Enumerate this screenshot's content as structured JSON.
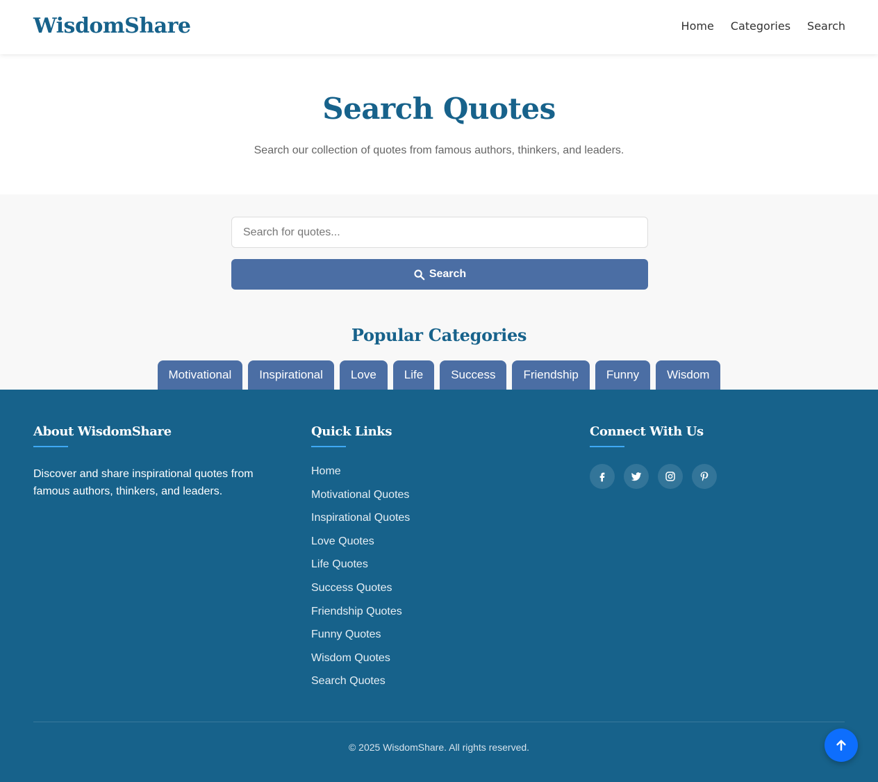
{
  "header": {
    "brand": "WisdomShare",
    "nav": [
      "Home",
      "Categories",
      "Search"
    ]
  },
  "hero": {
    "title": "Search Quotes",
    "subtitle": "Search our collection of quotes from famous authors, thinkers, and leaders."
  },
  "search": {
    "placeholder": "Search for quotes...",
    "value": "",
    "button_label": "Search",
    "button_icon": "search-icon"
  },
  "popular": {
    "title": "Popular Categories",
    "categories": [
      "Motivational",
      "Inspirational",
      "Love",
      "Life",
      "Success",
      "Friendship",
      "Funny",
      "Wisdom"
    ]
  },
  "footer": {
    "about_title": "About WisdomShare",
    "about_text": "Discover and share inspirational quotes from famous authors, thinkers, and leaders.",
    "links_title": "Quick Links",
    "links": [
      "Home",
      "Motivational Quotes",
      "Inspirational Quotes",
      "Love Quotes",
      "Life Quotes",
      "Success Quotes",
      "Friendship Quotes",
      "Funny Quotes",
      "Wisdom Quotes",
      "Search Quotes"
    ],
    "connect_title": "Connect With Us",
    "socials": [
      "facebook-icon",
      "twitter-icon",
      "instagram-icon",
      "pinterest-icon"
    ],
    "copyright": "© 2025 WisdomShare. All rights reserved."
  },
  "colors": {
    "brand": "#17628b",
    "button": "#4b6ea4",
    "accent_underline": "#3fa9f5",
    "to_top": "#0d6efd"
  },
  "back_to_top_icon": "arrow-up-icon"
}
